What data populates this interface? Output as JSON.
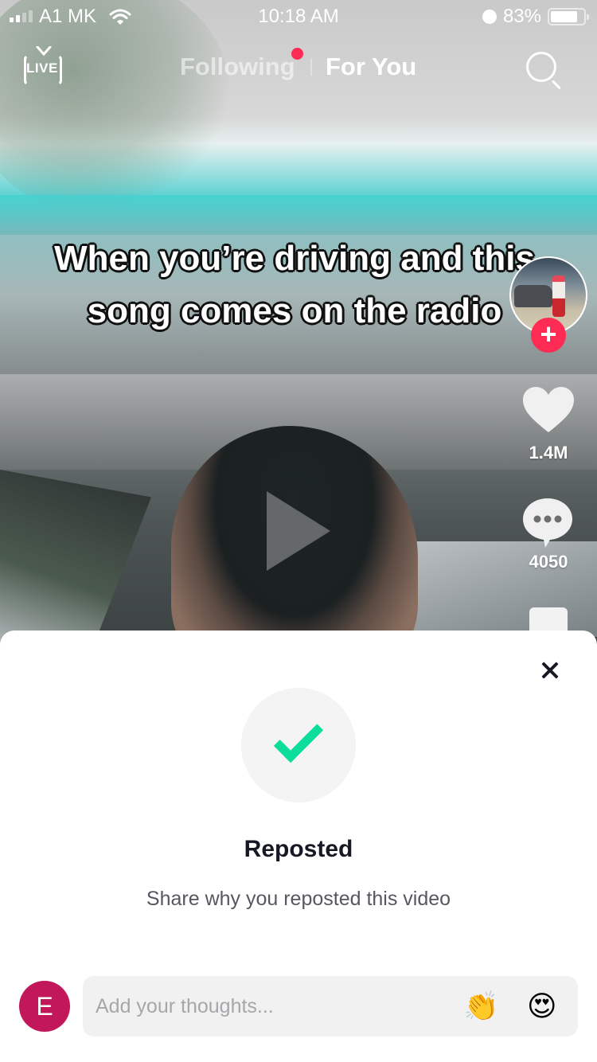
{
  "status_bar": {
    "carrier": "A1 MK",
    "time": "10:18 AM",
    "battery": "83%",
    "battery_level": 0.83,
    "icons": [
      "signal-icon",
      "wifi-icon",
      "alarm-icon",
      "battery-icon"
    ]
  },
  "top_nav": {
    "live_label": "LIVE",
    "tabs": [
      {
        "label": "Following",
        "active": false,
        "has_notification": true
      },
      {
        "label": "For You",
        "active": true
      }
    ],
    "search_icon": "search-icon"
  },
  "video": {
    "caption": "When you’re driving and this song comes on the radio",
    "state": "paused",
    "play_icon": "play-icon"
  },
  "right_rail": {
    "follow_label": "+",
    "likes": "1.4M",
    "comments": "4050",
    "like_icon": "heart-icon",
    "comment_icon": "comment-bubble-icon"
  },
  "repost_sheet": {
    "title": "Reposted",
    "subtitle": "Share why you reposted this video",
    "close_icon": "close-icon",
    "check_icon": "check-icon",
    "accent_color": "#0cdd9a",
    "user_initial": "E",
    "user_avatar_color": "#c2185b",
    "input": {
      "value": "",
      "placeholder": "Add your thoughts..."
    },
    "quick_emojis": [
      "👏",
      "😍"
    ]
  },
  "colors": {
    "brand_red": "#fe2c55",
    "text_dark": "#161823",
    "text_gray": "#57585f"
  }
}
